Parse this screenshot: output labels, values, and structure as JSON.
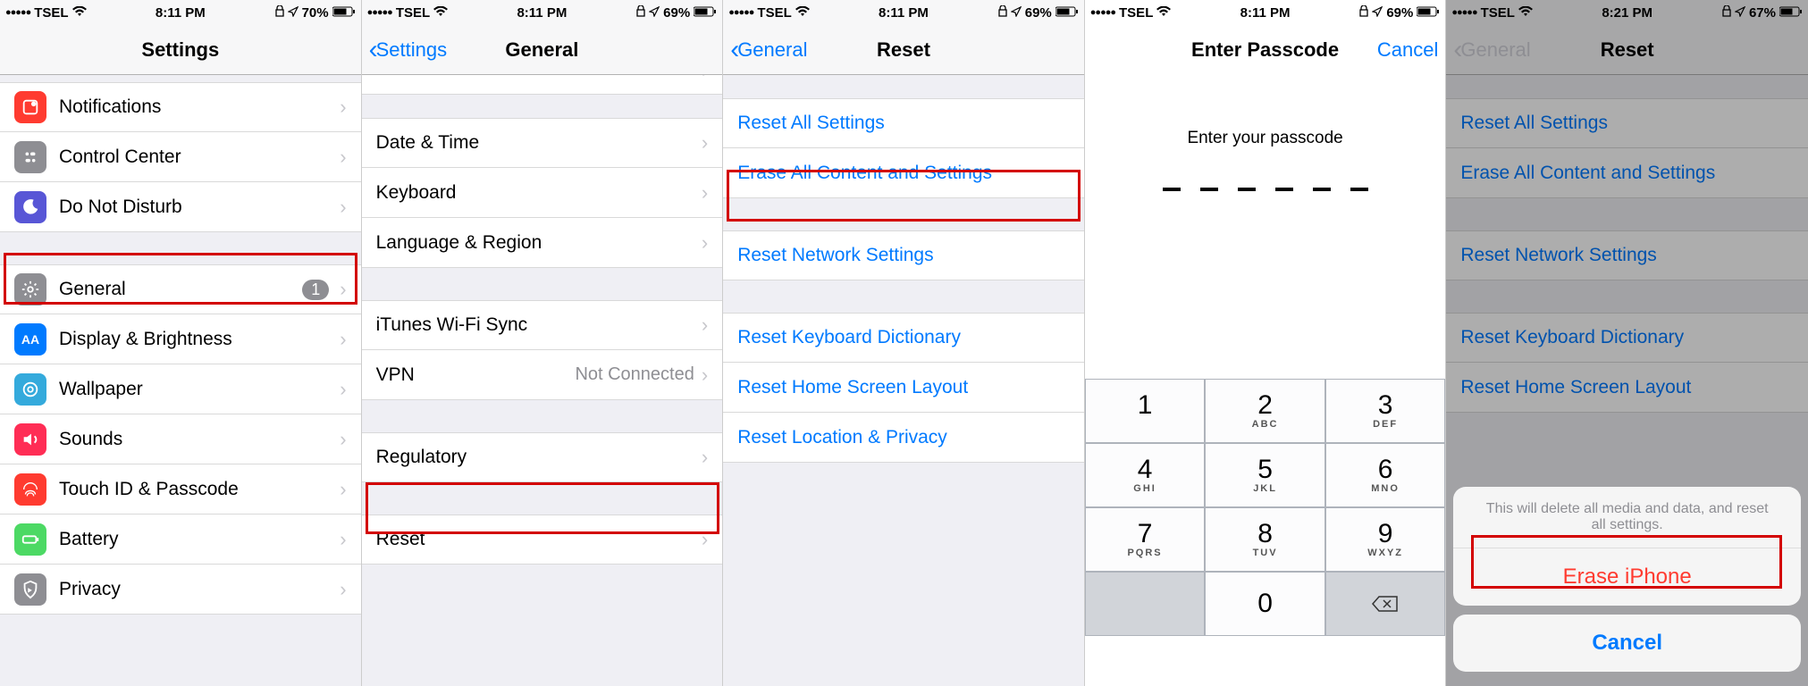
{
  "status": {
    "carrier": "TSEL",
    "times": [
      "8:11 PM",
      "8:11 PM",
      "8:11 PM",
      "8:11 PM",
      "8:21 PM"
    ],
    "batteries": [
      "70%",
      "69%",
      "69%",
      "69%",
      "67%"
    ]
  },
  "screen1": {
    "title": "Settings",
    "items": {
      "notifications": "Notifications",
      "control_center": "Control Center",
      "dnd": "Do Not Disturb",
      "general": "General",
      "general_badge": "1",
      "display": "Display & Brightness",
      "wallpaper": "Wallpaper",
      "sounds": "Sounds",
      "touchid": "Touch ID & Passcode",
      "battery": "Battery",
      "privacy": "Privacy"
    }
  },
  "screen2": {
    "back": "Settings",
    "title": "General",
    "items": {
      "date_time": "Date & Time",
      "keyboard": "Keyboard",
      "language": "Language & Region",
      "itunes_wifi": "iTunes Wi-Fi Sync",
      "vpn": "VPN",
      "vpn_value": "Not Connected",
      "regulatory": "Regulatory",
      "reset": "Reset"
    }
  },
  "screen3": {
    "back": "General",
    "title": "Reset",
    "items": {
      "reset_all": "Reset All Settings",
      "erase_all": "Erase All Content and Settings",
      "reset_network": "Reset Network Settings",
      "reset_keyboard": "Reset Keyboard Dictionary",
      "reset_home": "Reset Home Screen Layout",
      "reset_location": "Reset Location & Privacy"
    }
  },
  "screen4": {
    "title": "Enter Passcode",
    "cancel": "Cancel",
    "prompt": "Enter your passcode",
    "keys": {
      "k1": "1",
      "k2": "2",
      "k2l": "ABC",
      "k3": "3",
      "k3l": "DEF",
      "k4": "4",
      "k4l": "GHI",
      "k5": "5",
      "k5l": "JKL",
      "k6": "6",
      "k6l": "MNO",
      "k7": "7",
      "k7l": "PQRS",
      "k8": "8",
      "k8l": "TUV",
      "k9": "9",
      "k9l": "WXYZ",
      "k0": "0"
    }
  },
  "screen5": {
    "back": "General",
    "title": "Reset",
    "sheet_msg": "This will delete all media and data, and reset all settings.",
    "erase_btn": "Erase iPhone",
    "cancel_btn": "Cancel"
  },
  "colors": {
    "notifications": "#ff3b30",
    "control_center": "#8e8e93",
    "dnd": "#5856d6",
    "general": "#8e8e93",
    "display": "#007aff",
    "wallpaper": "#34aadc",
    "sounds": "#ff2d55",
    "touchid": "#ff3b30",
    "battery": "#4cd964",
    "privacy": "#8e8e93"
  }
}
